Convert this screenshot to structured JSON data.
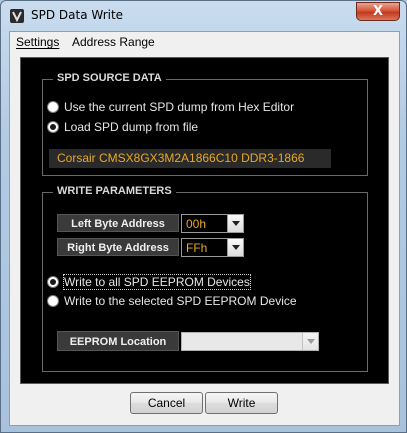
{
  "window": {
    "title": "SPD Data Write",
    "close_label": "X"
  },
  "menu": [
    {
      "label": "Settings",
      "underline": "S"
    },
    {
      "label": "Address Range",
      "underline": "A"
    }
  ],
  "spd_source": {
    "title": "SPD SOURCE DATA",
    "options": [
      {
        "label": "Use the current SPD dump from Hex Editor",
        "selected": false
      },
      {
        "label": "Load SPD dump from file",
        "selected": true
      }
    ],
    "file_name": "Corsair CMSX8GX3M2A1866C10 DDR3-1866"
  },
  "write_params": {
    "title": "WRITE PARAMETERS",
    "left_byte": {
      "label": "Left Byte Address",
      "value": "00h"
    },
    "right_byte": {
      "label": "Right Byte Address",
      "value": "FFh"
    },
    "options": [
      {
        "label": "Write to all SPD EEPROM Devices",
        "selected": true
      },
      {
        "label": "Write to the selected SPD EEPROM Device",
        "selected": false
      }
    ],
    "eeprom_location": {
      "label": "EEPROM Location",
      "value": ""
    }
  },
  "buttons": {
    "cancel": "Cancel",
    "write": "Write"
  },
  "colors": {
    "accent_text": "#e8a825",
    "panel_bg": "#000000",
    "close_red": "#c23a1e"
  }
}
